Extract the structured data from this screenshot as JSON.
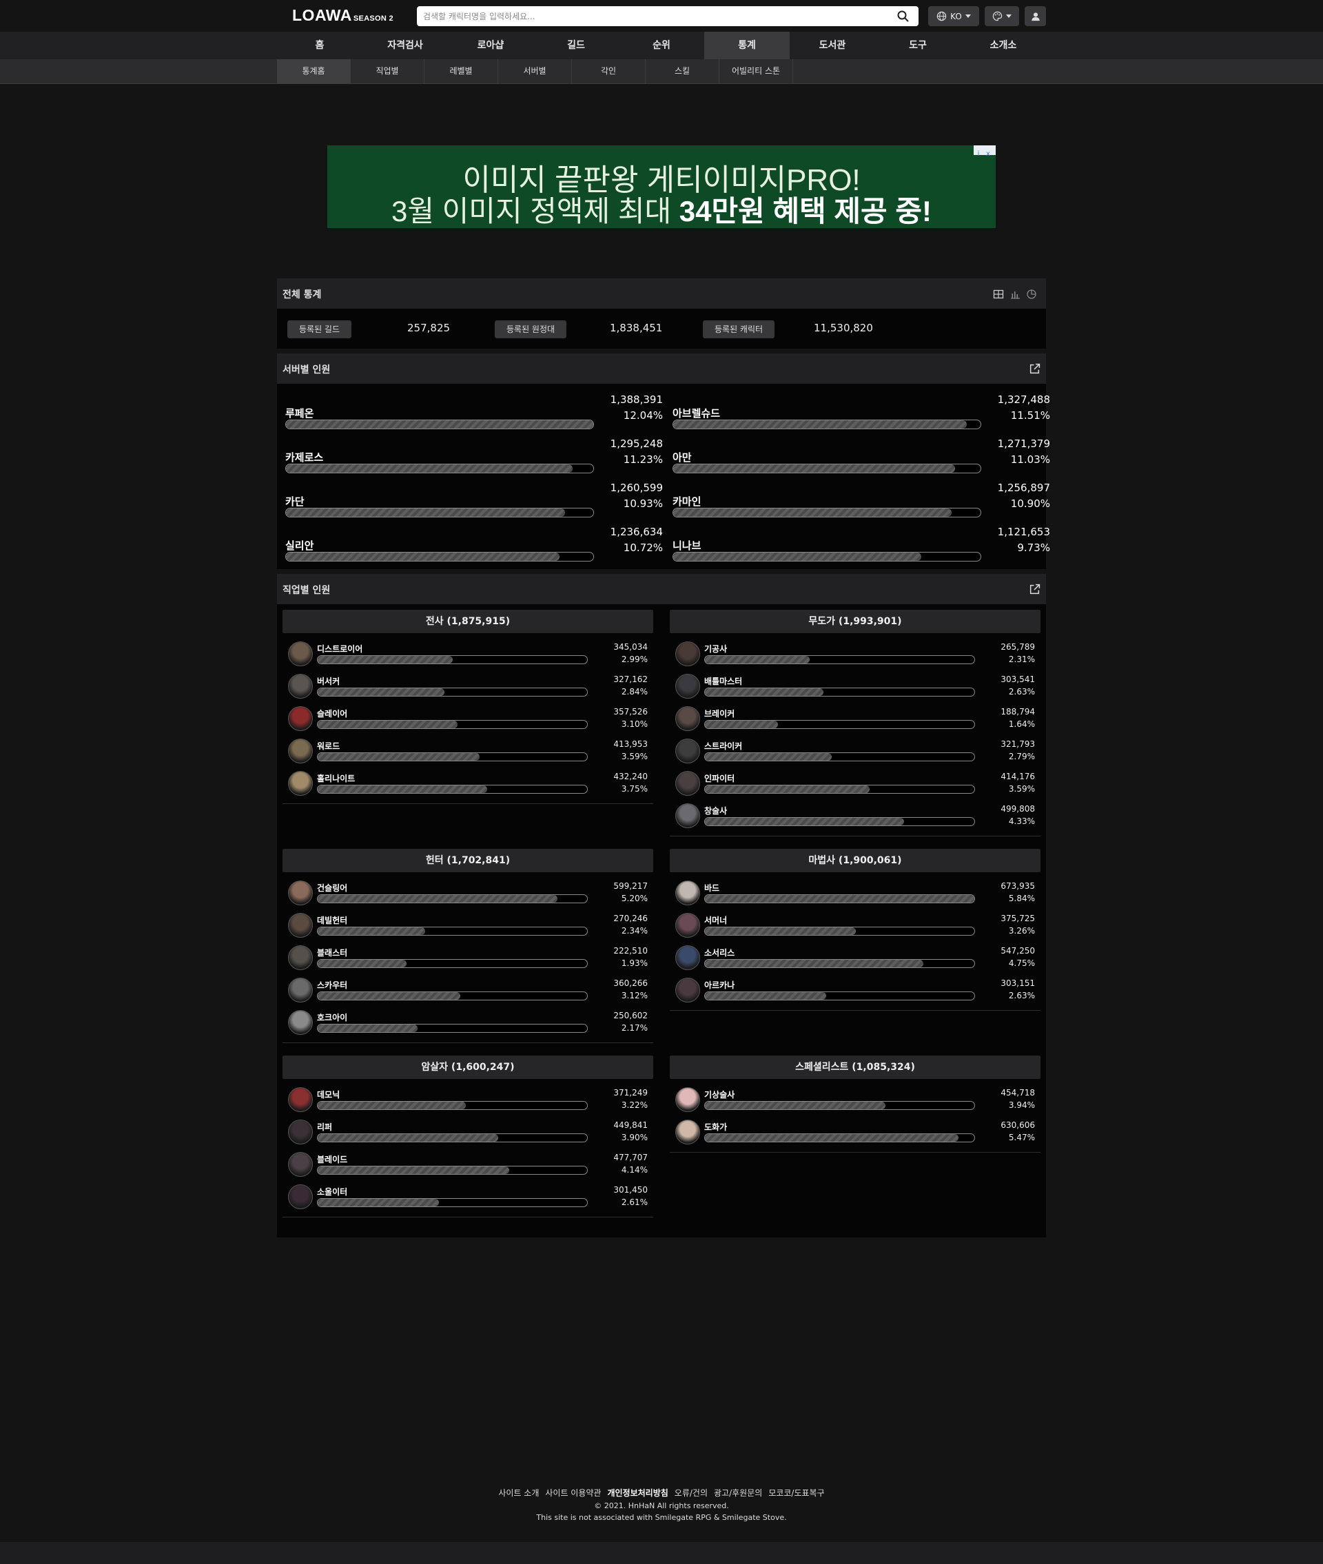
{
  "header": {
    "logo": "LOAWA",
    "logo_sub": "SEASON 2",
    "search_placeholder": "검색할 캐릭터명을 입력하세요...",
    "lang": "KO"
  },
  "main_nav": [
    "홈",
    "자격검사",
    "로아샵",
    "길드",
    "순위",
    "통계",
    "도서관",
    "도구",
    "소개소"
  ],
  "main_nav_active": "통계",
  "sub_nav": [
    "통계홈",
    "직업별",
    "레벨별",
    "서버별",
    "각인",
    "스킬",
    "어빌리티 스톤"
  ],
  "sub_nav_active": "통계홈",
  "banner": {
    "line1": "이미지 끝판왕 게티이미지PRO!",
    "line2_pre": "3월 이미지 정액제 최대 ",
    "line2_bold": "34만원 혜택 제공 중!",
    "ad_icons": [
      "i",
      "x"
    ]
  },
  "overall": {
    "title": "전체 통계",
    "items": [
      {
        "label": "등록된 길드",
        "value": "257,825"
      },
      {
        "label": "등록된 원정대",
        "value": "1,838,451"
      },
      {
        "label": "등록된 캐릭터",
        "value": "11,530,820"
      }
    ]
  },
  "servers": {
    "title": "서버별 인원",
    "items": [
      {
        "name": "루페온",
        "count": "1,388,391",
        "pct": "12.04%",
        "ratio": 1.0
      },
      {
        "name": "아브렐슈드",
        "count": "1,327,488",
        "pct": "11.51%",
        "ratio": 0.956
      },
      {
        "name": "카제로스",
        "count": "1,295,248",
        "pct": "11.23%",
        "ratio": 0.933
      },
      {
        "name": "아만",
        "count": "1,271,379",
        "pct": "11.03%",
        "ratio": 0.916
      },
      {
        "name": "카단",
        "count": "1,260,599",
        "pct": "10.93%",
        "ratio": 0.908
      },
      {
        "name": "카마인",
        "count": "1,256,897",
        "pct": "10.90%",
        "ratio": 0.905
      },
      {
        "name": "실리안",
        "count": "1,236,634",
        "pct": "10.72%",
        "ratio": 0.891
      },
      {
        "name": "니나브",
        "count": "1,121,653",
        "pct": "9.73%",
        "ratio": 0.808
      }
    ]
  },
  "classes": {
    "title": "직업별 인원",
    "groups": [
      {
        "title": "전사 (1,875,915)",
        "items": [
          {
            "name": "디스트로이어",
            "count": "345,034",
            "pct": "2.99%",
            "ratio": 0.5,
            "color": "#6b5a4a"
          },
          {
            "name": "버서커",
            "count": "327,162",
            "pct": "2.84%",
            "ratio": 0.47,
            "color": "#5a5550"
          },
          {
            "name": "슬레이어",
            "count": "357,526",
            "pct": "3.10%",
            "ratio": 0.52,
            "color": "#8a2a2a"
          },
          {
            "name": "워로드",
            "count": "413,953",
            "pct": "3.59%",
            "ratio": 0.6,
            "color": "#7a6a50"
          },
          {
            "name": "홀리나이트",
            "count": "432,240",
            "pct": "3.75%",
            "ratio": 0.63,
            "color": "#a08a6a"
          }
        ]
      },
      {
        "title": "무도가 (1,993,901)",
        "items": [
          {
            "name": "기공사",
            "count": "265,789",
            "pct": "2.31%",
            "ratio": 0.39,
            "color": "#4a3a35"
          },
          {
            "name": "배틀마스터",
            "count": "303,541",
            "pct": "2.63%",
            "ratio": 0.44,
            "color": "#3a3a40"
          },
          {
            "name": "브레이커",
            "count": "188,794",
            "pct": "1.64%",
            "ratio": 0.27,
            "color": "#5a4a45"
          },
          {
            "name": "스트라이커",
            "count": "321,793",
            "pct": "2.79%",
            "ratio": 0.47,
            "color": "#3d3d3d"
          },
          {
            "name": "인파이터",
            "count": "414,176",
            "pct": "3.59%",
            "ratio": 0.61,
            "color": "#4a4040"
          },
          {
            "name": "창술사",
            "count": "499,808",
            "pct": "4.33%",
            "ratio": 0.74,
            "color": "#6a6a70"
          }
        ]
      },
      {
        "title": "헌터 (1,702,841)",
        "items": [
          {
            "name": "건슬링어",
            "count": "599,217",
            "pct": "5.20%",
            "ratio": 0.89,
            "color": "#8a6a5a"
          },
          {
            "name": "데빌헌터",
            "count": "270,246",
            "pct": "2.34%",
            "ratio": 0.4,
            "color": "#5a4a40"
          },
          {
            "name": "블래스터",
            "count": "222,510",
            "pct": "1.93%",
            "ratio": 0.33,
            "color": "#55504a"
          },
          {
            "name": "스카우터",
            "count": "360,266",
            "pct": "3.12%",
            "ratio": 0.53,
            "color": "#6a6a6a"
          },
          {
            "name": "호크아이",
            "count": "250,602",
            "pct": "2.17%",
            "ratio": 0.37,
            "color": "#8a8a8a"
          }
        ]
      },
      {
        "title": "마법사 (1,900,061)",
        "items": [
          {
            "name": "바드",
            "count": "673,935",
            "pct": "5.84%",
            "ratio": 1.0,
            "color": "#c0b8b0"
          },
          {
            "name": "서머너",
            "count": "375,725",
            "pct": "3.26%",
            "ratio": 0.56,
            "color": "#6a4a55"
          },
          {
            "name": "소서리스",
            "count": "547,250",
            "pct": "4.75%",
            "ratio": 0.81,
            "color": "#3a4a6a"
          },
          {
            "name": "아르카나",
            "count": "303,151",
            "pct": "2.63%",
            "ratio": 0.45,
            "color": "#4a3a40"
          }
        ]
      },
      {
        "title": "암살자 (1,600,247)",
        "items": [
          {
            "name": "데모닉",
            "count": "371,249",
            "pct": "3.22%",
            "ratio": 0.55,
            "color": "#8a3030"
          },
          {
            "name": "리퍼",
            "count": "449,841",
            "pct": "3.90%",
            "ratio": 0.67,
            "color": "#3a3035"
          },
          {
            "name": "블레이드",
            "count": "477,707",
            "pct": "4.14%",
            "ratio": 0.71,
            "color": "#4a4045"
          },
          {
            "name": "소울이터",
            "count": "301,450",
            "pct": "2.61%",
            "ratio": 0.45,
            "color": "#3a2a35"
          }
        ]
      },
      {
        "title": "스페셜리스트 (1,085,324)",
        "items": [
          {
            "name": "기상술사",
            "count": "454,718",
            "pct": "3.94%",
            "ratio": 0.67,
            "color": "#e0b8b8"
          },
          {
            "name": "도화가",
            "count": "630,606",
            "pct": "5.47%",
            "ratio": 0.94,
            "color": "#d0b8a8"
          }
        ]
      }
    ]
  },
  "footer": {
    "links": [
      "사이트 소개",
      "사이트 이용약관",
      "개인정보처리방침",
      "오류/건의",
      "광고/후원문의",
      "모코코/도표복구"
    ],
    "bold_link": "개인정보처리방침",
    "copyright": "© 2021. HnHaN All rights reserved.",
    "disclaimer": "This site is not associated with Smilegate RPG & Smilegate Stove."
  },
  "colors": {
    "accent_bg": "#0f4a26",
    "panel": "#212123",
    "page": "#141415"
  }
}
